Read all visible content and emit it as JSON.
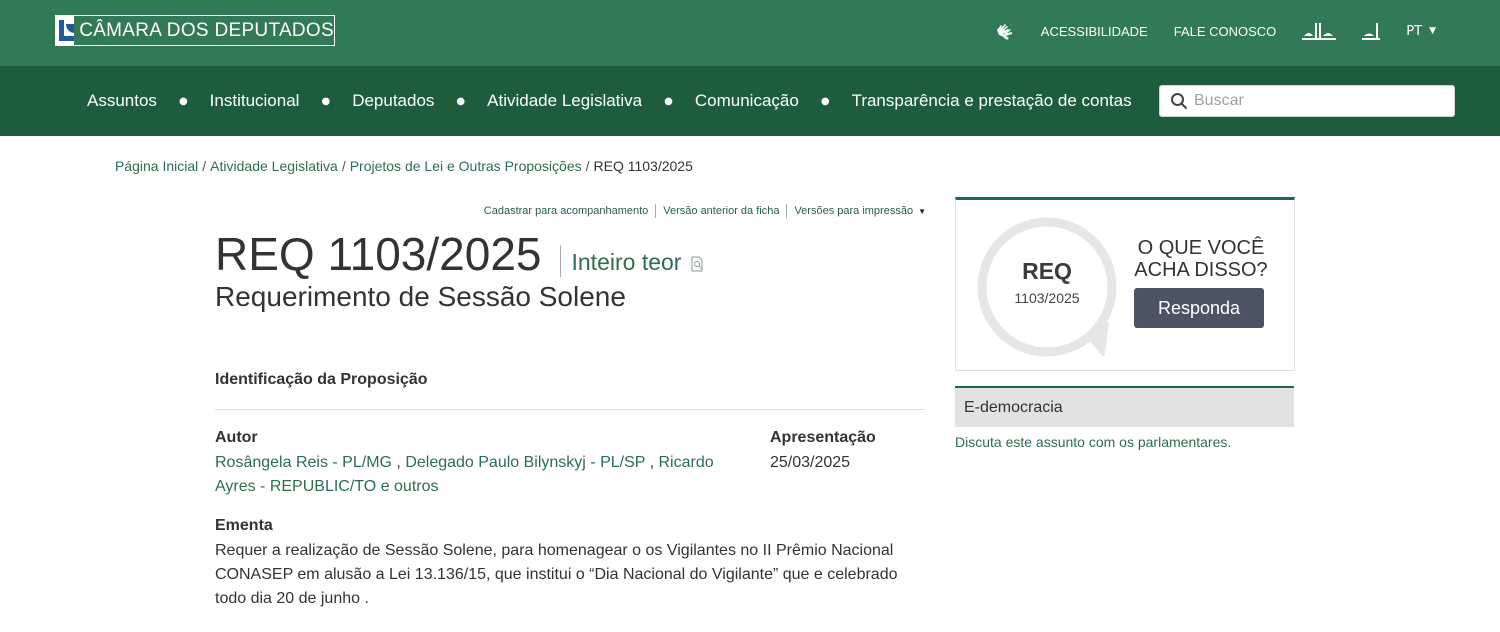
{
  "header": {
    "logo_text": "CÂMARA DOS DEPUTADOS",
    "accessibility_label": "ACESSIBILIDADE",
    "contact_label": "FALE CONOSCO",
    "language": "PT"
  },
  "nav": {
    "items": [
      "Assuntos",
      "Institucional",
      "Deputados",
      "Atividade Legislativa",
      "Comunicação",
      "Transparência e prestação de contas"
    ],
    "search_placeholder": "Buscar"
  },
  "breadcrumb": {
    "items": [
      "Página Inicial",
      "Atividade Legislativa",
      "Projetos de Lei e Outras Proposições"
    ],
    "current": "REQ 1103/2025"
  },
  "actions": {
    "follow": "Cadastrar para acompanhamento",
    "previous_version": "Versão anterior da ficha",
    "print_versions": "Versões para impressão"
  },
  "proposition": {
    "title": "REQ 1103/2025",
    "full_text_link": "Inteiro teor",
    "subtitle": "Requerimento de Sessão Solene",
    "section_title": "Identificação da Proposição",
    "author_label": "Autor",
    "authors": [
      "Rosângela Reis - PL/MG",
      "Delegado Paulo Bilynskyj - PL/SP",
      "Ricardo Ayres - REPUBLIC/TO"
    ],
    "authors_more": "e outros",
    "presentation_label": "Apresentação",
    "presentation_date": "25/03/2025",
    "ementa_label": "Ementa",
    "ementa_text": "Requer a realização de Sessão Solene, para homenagear o os Vigilantes no II Prêmio Nacional CONASEP em alusão a Lei 13.136/15, que institui o “Dia Nacional do Vigilante” que e celebrado todo dia 20 de junho ."
  },
  "sidebar": {
    "bubble_type": "REQ",
    "bubble_number": "1103/2025",
    "question": "O QUE VOCÊ ACHA DISSO?",
    "respond_button": "Responda",
    "edemocracia_title": "E-democracia",
    "edemocracia_link": "Discuta este assunto com os parlamentares."
  },
  "colors": {
    "topbar": "#317a55",
    "navbar": "#1d5d3c",
    "link": "#2d6e4e",
    "button": "#4a5462"
  }
}
